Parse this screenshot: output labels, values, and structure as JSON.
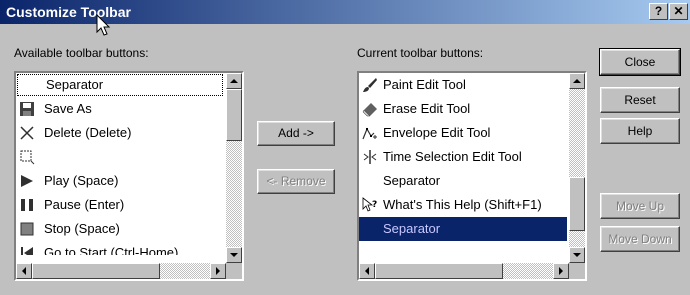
{
  "window": {
    "title": "Customize Toolbar",
    "help_glyph": "?",
    "close_glyph": "✕"
  },
  "available": {
    "label": "Available toolbar buttons:",
    "items": [
      {
        "label": "Separator",
        "icon": "none"
      },
      {
        "label": "Save As",
        "icon": "save-as-icon"
      },
      {
        "label": "Delete (Delete)",
        "icon": "delete-x-icon"
      },
      {
        "label": "",
        "icon": "crop-icon"
      },
      {
        "label": "Play (Space)",
        "icon": "play-icon"
      },
      {
        "label": "Pause (Enter)",
        "icon": "pause-icon"
      },
      {
        "label": "Stop (Space)",
        "icon": "stop-icon"
      },
      {
        "label": "Go to Start (Ctrl-Home)",
        "icon": "go-to-start-icon"
      }
    ]
  },
  "current": {
    "label": "Current toolbar buttons:",
    "items": [
      {
        "label": "Paint Edit Tool",
        "icon": "paint-brush-icon"
      },
      {
        "label": "Erase Edit Tool",
        "icon": "eraser-icon"
      },
      {
        "label": "Envelope Edit Tool",
        "icon": "envelope-tool-icon"
      },
      {
        "label": "Time Selection Edit Tool",
        "icon": "time-selection-icon"
      },
      {
        "label": "Separator",
        "icon": "none"
      },
      {
        "label": "What's This Help (Shift+F1)",
        "icon": "whats-this-help-icon"
      },
      {
        "label": "Separator",
        "icon": "none",
        "selected": true
      }
    ]
  },
  "buttons": {
    "add": "Add ->",
    "remove": "<- Remove",
    "close": "Close",
    "reset": "Reset",
    "help": "Help",
    "move_up": "Move Up",
    "move_down": "Move Down"
  },
  "colors": {
    "titlebar_start": "#0a246a",
    "titlebar_end": "#a6caf0",
    "selection": "#0a246a",
    "face": "#c0c0c0"
  }
}
